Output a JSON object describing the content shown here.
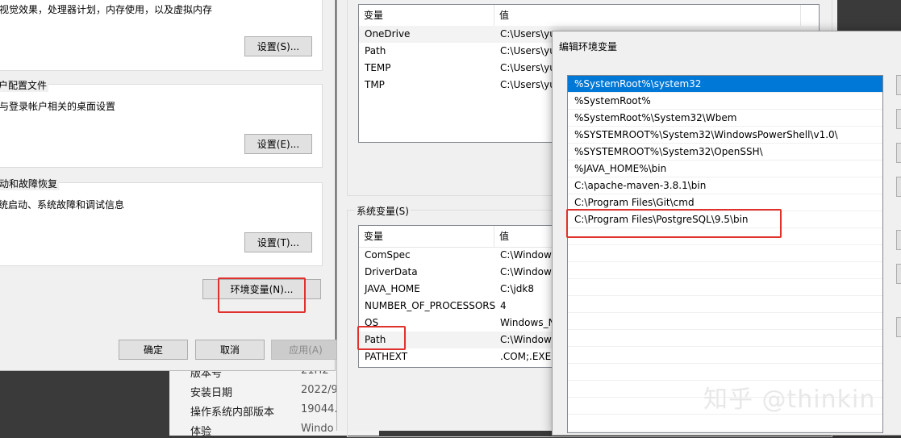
{
  "about_window": {
    "rows": [
      {
        "label": "版本号",
        "value": "21H2"
      },
      {
        "label": "安装日期",
        "value": "2022/9/"
      },
      {
        "label": "操作系统内部版本",
        "value": "19044."
      },
      {
        "label": "体验",
        "value": "Windo"
      }
    ]
  },
  "system_properties": {
    "performance": {
      "desc": "视觉效果，处理器计划，内存使用，以及虚拟内存",
      "button": "设置(S)..."
    },
    "user_profiles": {
      "title": "用户配置文件",
      "desc": "与登录帐户相关的桌面设置",
      "button": "设置(E)..."
    },
    "startup_recovery": {
      "title": "启动和故障恢复",
      "desc": "系统启动、系统故障和调试信息",
      "button": "设置(T)..."
    },
    "env_button": "环境变量(N)...",
    "ok": "确定",
    "cancel": "取消",
    "apply": "应用(A)"
  },
  "env_window": {
    "user_vars": {
      "headers": {
        "name": "变量",
        "value": "值"
      },
      "rows": [
        {
          "name": "OneDrive",
          "value": "C:\\Users\\yu"
        },
        {
          "name": "Path",
          "value": "C:\\Users\\yu"
        },
        {
          "name": "TEMP",
          "value": "C:\\Users\\yu"
        },
        {
          "name": "TMP",
          "value": "C:\\Users\\yu"
        }
      ]
    },
    "system_vars_label": "系统变量(S)",
    "system_vars": {
      "headers": {
        "name": "变量",
        "value": "值"
      },
      "rows": [
        {
          "name": "ComSpec",
          "value": "C:\\Windows"
        },
        {
          "name": "DriverData",
          "value": "C:\\Window"
        },
        {
          "name": "JAVA_HOME",
          "value": "C:\\jdk8"
        },
        {
          "name": "NUMBER_OF_PROCESSORS",
          "value": "4"
        },
        {
          "name": "OS",
          "value": "Windows_N"
        },
        {
          "name": "Path",
          "value": "C:\\Window"
        },
        {
          "name": "PATHEXT",
          "value": ".COM;.EXE;"
        }
      ]
    }
  },
  "edit_dialog": {
    "title": "编辑环境变量",
    "items": [
      "%SystemRoot%\\system32",
      "%SystemRoot%",
      "%SystemRoot%\\System32\\Wbem",
      "%SYSTEMROOT%\\System32\\WindowsPowerShell\\v1.0\\",
      "%SYSTEMROOT%\\System32\\OpenSSH\\",
      "%JAVA_HOME%\\bin",
      "C:\\apache-maven-3.8.1\\bin",
      "C:\\Program Files\\Git\\cmd",
      "C:\\Program Files\\PostgreSQL\\9.5\\bin"
    ]
  },
  "watermark": "知乎 @thinkin",
  "colors": {
    "highlight": "#e0312c",
    "selection": "#0078d7"
  }
}
